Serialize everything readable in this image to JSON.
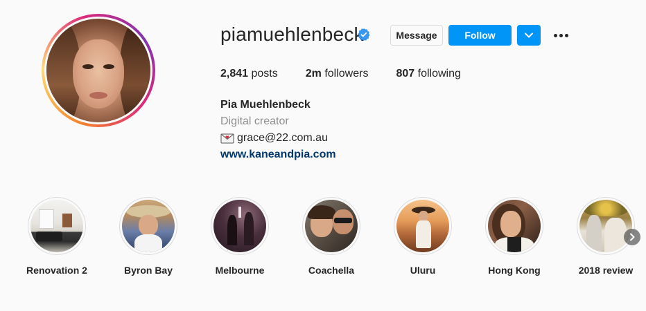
{
  "profile": {
    "username": "piamuehlenbeck",
    "verified": true,
    "full_name": "Pia Muehlenbeck",
    "category": "Digital creator",
    "email": "grace@22.com.au",
    "website": "www.kaneandpia.com"
  },
  "actions": {
    "message_label": "Message",
    "follow_label": "Follow",
    "dropdown_icon": "chevron-down-icon",
    "more_icon": "more-horizontal-icon"
  },
  "stats": {
    "posts_count": "2,841",
    "posts_label": "posts",
    "followers_count": "2m",
    "followers_label": "followers",
    "following_count": "807",
    "following_label": "following"
  },
  "highlights": [
    {
      "label": "Renovation 2"
    },
    {
      "label": "Byron Bay"
    },
    {
      "label": "Melbourne"
    },
    {
      "label": "Coachella"
    },
    {
      "label": "Uluru"
    },
    {
      "label": "Hong Kong"
    },
    {
      "label": "2018 review"
    }
  ],
  "colors": {
    "accent": "#0095f6",
    "link": "#00376b",
    "secondary_text": "#8e8e8e",
    "verified": "#3897f0"
  }
}
